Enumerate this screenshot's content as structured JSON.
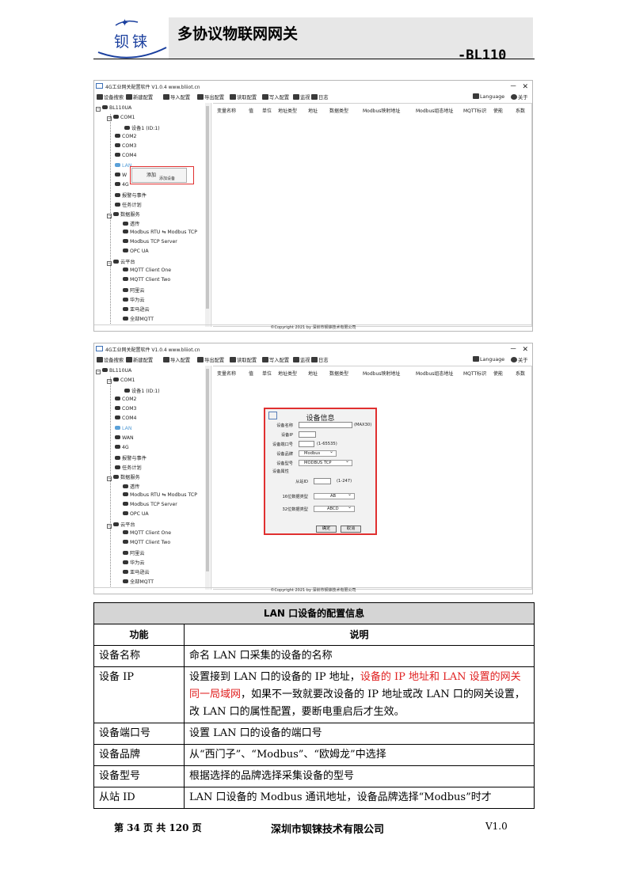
{
  "header": {
    "logo_text": "钡铼",
    "title": "多协议物联网网关",
    "model": "-BL110"
  },
  "app": {
    "window_title": "4G工业网关配置软件 V1.0.4 www.bliiot.cn",
    "window_controls": "－ ✕",
    "toolbar": [
      "设备搜索",
      "新建配置",
      "导入配置",
      "导出配置",
      "读取配置",
      "写入配置",
      "监视",
      "日志"
    ],
    "language_label": "Language",
    "about_label": "关于",
    "tree": {
      "root": "BL110UA",
      "com1": "COM1",
      "device1": "设备1 (ID:1)",
      "com2": "COM2",
      "com3": "COM3",
      "com4": "COM4",
      "lan": "LAN",
      "wan": "WAN",
      "g4": "4G",
      "alarm": "报警与事件",
      "task": "任务计划",
      "data_service": "数据服务",
      "transparent": "透传",
      "modbus_rtu_tcp": "Modbus RTU ⇆ Modbus TCP",
      "modbus_tcp_server": "Modbus TCP Server",
      "opc_ua": "OPC UA",
      "cloud": "云平台",
      "mqtt_one": "MQTT Client One",
      "mqtt_two": "MQTT Client Two",
      "aliyun": "阿里云",
      "huawei": "华为云",
      "amazon": "亚马逊云",
      "all_mqtt": "全部MQTT"
    },
    "columns": [
      "变量名称",
      "值",
      "单位",
      "地址类型",
      "地址",
      "数据类型",
      "Modbus映射地址",
      "Modbus组态地址",
      "MQTT标识",
      "使能",
      "系数"
    ],
    "copyright": "©Copyright 2021 by 深圳市钡铼技术有限公司",
    "context_menu": {
      "item": "添加",
      "sub": "添加设备"
    },
    "dialog": {
      "title": "设备信息",
      "name_label": "设备名称",
      "name_hint": "(MAX30)",
      "ip_label": "设备IP",
      "port_label": "设备端口号",
      "port_hint": "(1-65535)",
      "brand_label": "设备品牌",
      "brand_value": "Modbus",
      "model_label": "设备型号",
      "model_value": "MODBUS TCP",
      "attr_label": "设备属性",
      "slave_label": "从站ID",
      "slave_hint": "(1-247)",
      "t16_label": "16位数据类型",
      "t16_value": "AB",
      "t32_label": "32位数据类型",
      "t32_value": "ABCD",
      "ok": "确定",
      "cancel": "取消"
    }
  },
  "table": {
    "caption": "LAN 口设备的配置信息",
    "head_func": "功能",
    "head_desc": "说明",
    "rows": [
      {
        "func": "设备名称",
        "desc": "命名 LAN 口采集的设备的名称"
      },
      {
        "func": "设备 IP",
        "desc_a": "设置接到 LAN 口的设备的 IP 地址，",
        "desc_red": "设备的 IP 地址和 LAN 设置的网关同一局域网",
        "desc_b": "，如果不一致就要改设备的 IP 地址或改 LAN 口的网关设置，改 LAN 口的属性配置，要断电重启后才生效。"
      },
      {
        "func": "设备端口号",
        "desc": "设置 LAN 口的设备的端口号"
      },
      {
        "func": "设备品牌",
        "desc": "从“西门子”、“Modbus”、“欧姆龙”中选择"
      },
      {
        "func": "设备型号",
        "desc": "根据选择的品牌选择采集设备的型号"
      },
      {
        "func": "从站 ID",
        "desc": "LAN 口设备的 Modbus 通讯地址，设备品牌选择“Modbus”时才"
      }
    ]
  },
  "footer": {
    "page": "第 34 页 共 120 页",
    "company": "深圳市钡铼技术有限公司",
    "version": "V1.0"
  }
}
